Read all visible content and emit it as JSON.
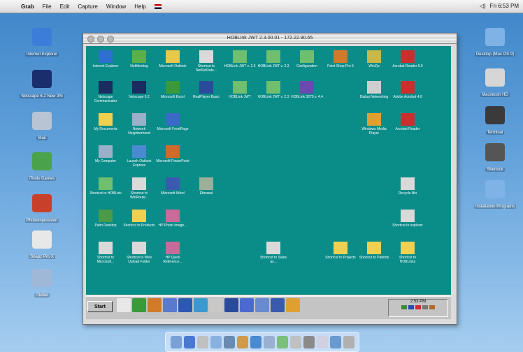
{
  "menubar": {
    "app_name": "Grab",
    "items": [
      "File",
      "Edit",
      "Capture",
      "Window",
      "Help"
    ],
    "clock": "Fri 6:53 PM"
  },
  "desktop": {
    "left_icons": [
      {
        "label": "Internet Explorer",
        "icon": "ie-icon",
        "color": "#3b7dd8"
      },
      {
        "label": "Netscape 6.2 New 3%",
        "icon": "netscape-icon",
        "color": "#1a2e6e"
      },
      {
        "label": "Mail",
        "icon": "mail-icon",
        "color": "#b8c4d4"
      },
      {
        "label": "iTools Games",
        "icon": "games-icon",
        "color": "#4aa34a"
      },
      {
        "label": "Photoimpression",
        "icon": "photo-icon",
        "color": "#c8402a"
      },
      {
        "label": "Snapz Pro X",
        "icon": "snapz-icon",
        "color": "#e8e8e8"
      },
      {
        "label": "iTunes",
        "icon": "itunes-icon",
        "color": "#9fb8d8"
      }
    ],
    "right_icons": [
      {
        "label": "Desktop (Mac OS 9)",
        "icon": "folder-icon",
        "color": "#7fb3e6"
      },
      {
        "label": "Macintosh HD",
        "icon": "hard-drive-icon",
        "color": "#d6d6d6"
      },
      {
        "label": "Terminal",
        "icon": "terminal-icon",
        "color": "#3a3a3a"
      },
      {
        "label": "Sherlock",
        "icon": "sherlock-icon",
        "color": "#555555"
      },
      {
        "label": "Installation Programs",
        "icon": "folder-icon",
        "color": "#7fb3e6"
      }
    ]
  },
  "vnc": {
    "title": "HOBLink JWT 2.3.00.01  -  172.22.90.65",
    "windows_icons": [
      {
        "label": "Internet Explorer",
        "color": "#2f6fd0"
      },
      {
        "label": "NetMeeting",
        "color": "#5bb04a"
      },
      {
        "label": "Microsoft Outlook",
        "color": "#e8c84a"
      },
      {
        "label": "Shortcut to NetSetDate...",
        "color": "#d9d9d9"
      },
      {
        "label": "HOBLink JWT v. 2.3",
        "color": "#6fbf6f"
      },
      {
        "label": "HOBLink JWT v. 2.3",
        "color": "#6fbf6f"
      },
      {
        "label": "Configuration",
        "color": "#6fbf6f"
      },
      {
        "label": "Paint Shop Pro 5",
        "color": "#d27a2a"
      },
      {
        "label": "WinZip",
        "color": "#c8b84a"
      },
      {
        "label": "Acrobat Reader 5.0",
        "color": "#c83030"
      },
      {
        "label": "Netscape Communicator",
        "color": "#1b2c60"
      },
      {
        "label": "Netscape 6.2",
        "color": "#1b2c60"
      },
      {
        "label": "Microsoft Excel",
        "color": "#3a9a3a"
      },
      {
        "label": "RealPlayer Basic",
        "color": "#2a4a9a"
      },
      {
        "label": "HOBLink JWT",
        "color": "#6fbf6f"
      },
      {
        "label": "HOBLink JWT v. 2.3",
        "color": "#6fbf6f"
      },
      {
        "label": "HOBLink 3270 v. 4.4",
        "color": "#6a4ab0"
      },
      {
        "label": "Dialup Networking",
        "color": "#cfcfcf"
      },
      {
        "label": "Adobe Acrobat 4.0",
        "color": "#c83030"
      },
      {
        "label": "My Documents",
        "color": "#f0d050"
      },
      {
        "label": "Network Neighborhood",
        "color": "#9ab0c8"
      },
      {
        "label": "Microsoft FrontPage",
        "color": "#3a6ac8"
      },
      {
        "label": "Windows Media Player",
        "color": "#e0a030"
      },
      {
        "label": "Acrobat Reader",
        "color": "#c83030"
      },
      {
        "label": "My Computer",
        "color": "#9ab0c8"
      },
      {
        "label": "Launch Outlook Express",
        "color": "#4a8ad0"
      },
      {
        "label": "Microsoft PowerPoint",
        "color": "#d06a2a"
      },
      {
        "label": "Shortcut to HOBLink",
        "color": "#6fbf6f"
      },
      {
        "label": "Shortcut to WinRoute...",
        "color": "#d9d9d9"
      },
      {
        "label": "Microsoft Word",
        "color": "#3a5ab0"
      },
      {
        "label": "Ethereal",
        "color": "#9ab09a"
      },
      {
        "label": "Recycle Bin",
        "color": "#d9d9d9"
      },
      {
        "label": "Palm Desktop",
        "color": "#4a9a4a"
      },
      {
        "label": "Shortcut to Products",
        "color": "#f0d050"
      },
      {
        "label": "HP Photo Image...",
        "color": "#c86a9a"
      },
      {
        "label": "Shortcut to explorer",
        "color": "#d9d9d9"
      },
      {
        "label": "Shortcut to Microsoft...",
        "color": "#d9d9d9"
      },
      {
        "label": "Shortcut to Web Upload Folder",
        "color": "#d9d9d9"
      },
      {
        "label": "HP Quick Reference...",
        "color": "#c86a9a"
      },
      {
        "label": "Shortcut to Sales as...",
        "color": "#d9d9d9"
      },
      {
        "label": "Shortcut to Projects",
        "color": "#f0d050"
      },
      {
        "label": "Shortcut to Patents",
        "color": "#f0d050"
      },
      {
        "label": "Shortcut to HOBLinks",
        "color": "#f0d050"
      }
    ],
    "taskbar": {
      "start_label": "Start",
      "clock": "2:53 PM"
    }
  },
  "dock_count": 14
}
